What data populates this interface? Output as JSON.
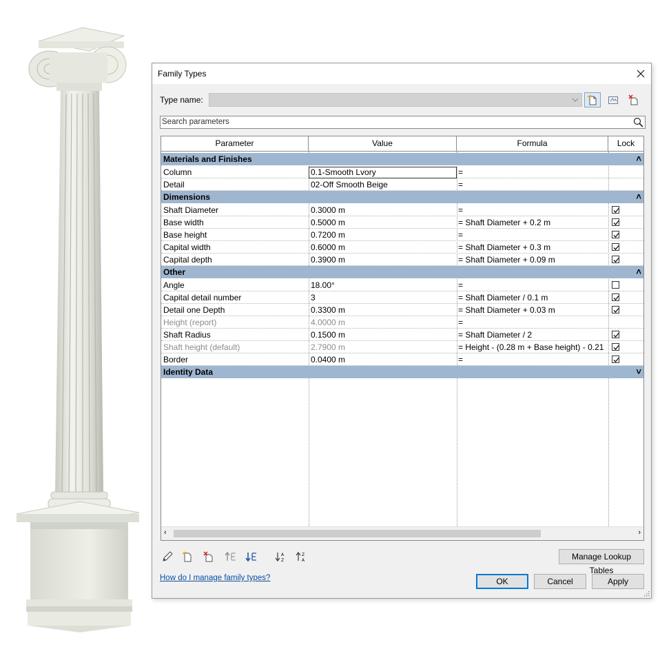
{
  "dialog": {
    "title": "Family Types",
    "type_name_label": "Type name:",
    "type_name_value": "",
    "search_placeholder": "Search parameters"
  },
  "columns": [
    "Parameter",
    "Value",
    "Formula",
    "Lock"
  ],
  "groups": [
    {
      "name": "Materials and Finishes",
      "expanded": true,
      "rows": [
        {
          "parameter": "Column",
          "value": "0.1-Smooth Lvory",
          "formula": "=",
          "lock": null,
          "selected": true
        },
        {
          "parameter": "Detail",
          "value": "02-Off Smooth Beige",
          "formula": "=",
          "lock": null
        }
      ]
    },
    {
      "name": "Dimensions",
      "expanded": true,
      "rows": [
        {
          "parameter": "Shaft Diameter",
          "value": "0.3000 m",
          "formula": "=",
          "lock": true
        },
        {
          "parameter": "Base width",
          "value": "0.5000 m",
          "formula": "= Shaft Diameter + 0.2 m",
          "lock": true
        },
        {
          "parameter": "Base height",
          "value": "0.7200 m",
          "formula": "=",
          "lock": true
        },
        {
          "parameter": "Capital width",
          "value": "0.6000 m",
          "formula": "= Shaft Diameter + 0.3 m",
          "lock": true
        },
        {
          "parameter": "Capital depth",
          "value": "0.3900 m",
          "formula": "= Shaft Diameter + 0.09 m",
          "lock": true
        }
      ]
    },
    {
      "name": "Other",
      "expanded": true,
      "rows": [
        {
          "parameter": "Angle",
          "value": "18.00°",
          "formula": "=",
          "lock": false
        },
        {
          "parameter": "Capital detail number",
          "value": "3",
          "formula": "= Shaft Diameter / 0.1 m",
          "lock": true
        },
        {
          "parameter": "Detail one Depth",
          "value": "0.3300 m",
          "formula": "= Shaft Diameter + 0.03 m",
          "lock": true
        },
        {
          "parameter": "Height (report)",
          "value": "4.0000 m",
          "formula": "=",
          "lock": null,
          "dim": true
        },
        {
          "parameter": "Shaft Radius",
          "value": "0.1500 m",
          "formula": "= Shaft Diameter / 2",
          "lock": true
        },
        {
          "parameter": "Shaft height (default)",
          "value": "2.7900 m",
          "formula": "= Height - (0.28 m + Base height) - 0.21",
          "lock": true,
          "dim": true
        },
        {
          "parameter": "Border",
          "value": "0.0400 m",
          "formula": "=",
          "lock": true
        }
      ]
    },
    {
      "name": "Identity Data",
      "expanded": false,
      "rows": []
    }
  ],
  "buttons": {
    "manage_lookup": "Manage Lookup Tables",
    "ok": "OK",
    "cancel": "Cancel",
    "apply": "Apply"
  },
  "help_link": "How do I manage family types?",
  "toolbar_icons": [
    "new-type-icon",
    "rename-type-icon",
    "delete-type-icon"
  ],
  "bottom_icons": [
    "edit-parameter-icon",
    "new-parameter-icon",
    "delete-parameter-icon",
    "move-up-icon",
    "move-down-icon",
    "sort-ascending-icon",
    "sort-descending-icon"
  ],
  "colors": {
    "group_header": "#9fb6d0",
    "link": "#0b4ea2",
    "primary_border": "#0078d7"
  }
}
